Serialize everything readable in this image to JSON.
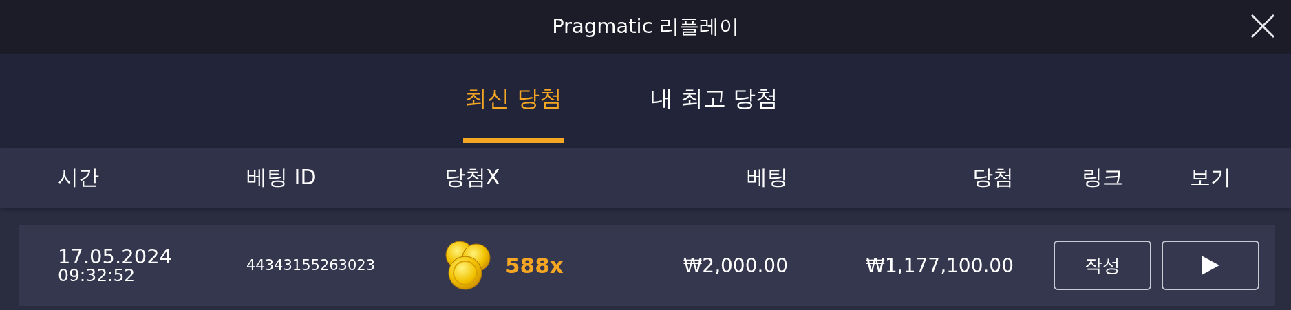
{
  "window": {
    "title": "Pragmatic 리플레이"
  },
  "tabs": [
    {
      "label": "최신 당첨",
      "selected": true
    },
    {
      "label": "내 최고 당첨",
      "selected": false
    }
  ],
  "table": {
    "columns": [
      "시간",
      "베팅 ID",
      "당첨X",
      "베팅",
      "당첨",
      "링크",
      "보기"
    ],
    "rows": [
      {
        "date": "17.05.2024",
        "time": "09:32:52",
        "bet_id": "44343155263023",
        "multiplier": "588x",
        "bet": "₩2,000.00",
        "win": "₩1,177,100.00",
        "link_button": "작성"
      }
    ]
  }
}
